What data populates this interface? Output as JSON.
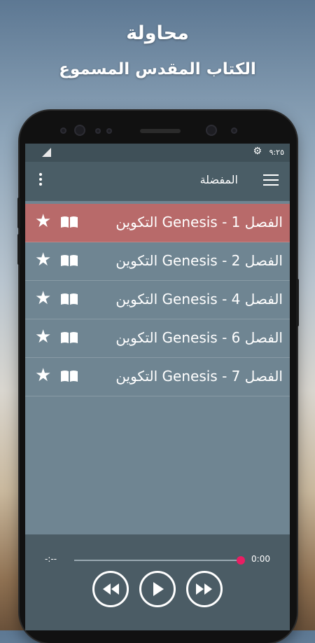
{
  "promo": {
    "line1": "محاولة",
    "line2": "الكتاب المقدس المسموع"
  },
  "statusbar": {
    "time": "٩:٢٥",
    "icons": [
      "signal-icon",
      "gear-icon"
    ]
  },
  "appbar": {
    "title": "المفضلة",
    "menu_icon": "hamburger-menu-icon",
    "more_icon": "more-vertical-icon"
  },
  "favorites": [
    {
      "title": "التكوين Genesis - الفصل 1",
      "active": true
    },
    {
      "title": "التكوين Genesis - الفصل 2",
      "active": false
    },
    {
      "title": "التكوين Genesis - الفصل 4",
      "active": false
    },
    {
      "title": "التكوين Genesis - الفصل 6",
      "active": false
    },
    {
      "title": "التكوين Genesis - الفصل 7",
      "active": false
    }
  ],
  "row_icons": [
    "star-icon",
    "book-icon"
  ],
  "player": {
    "elapsed": "0:00",
    "duration": "-:--",
    "progress": 1.0,
    "accent_color": "#e91e63",
    "controls": [
      "rewind-icon",
      "play-icon",
      "fast-forward-icon"
    ]
  },
  "colors": {
    "active_row": "#b86a6a",
    "appbar": "#4a5d66",
    "list_bg": "#6f8592"
  }
}
